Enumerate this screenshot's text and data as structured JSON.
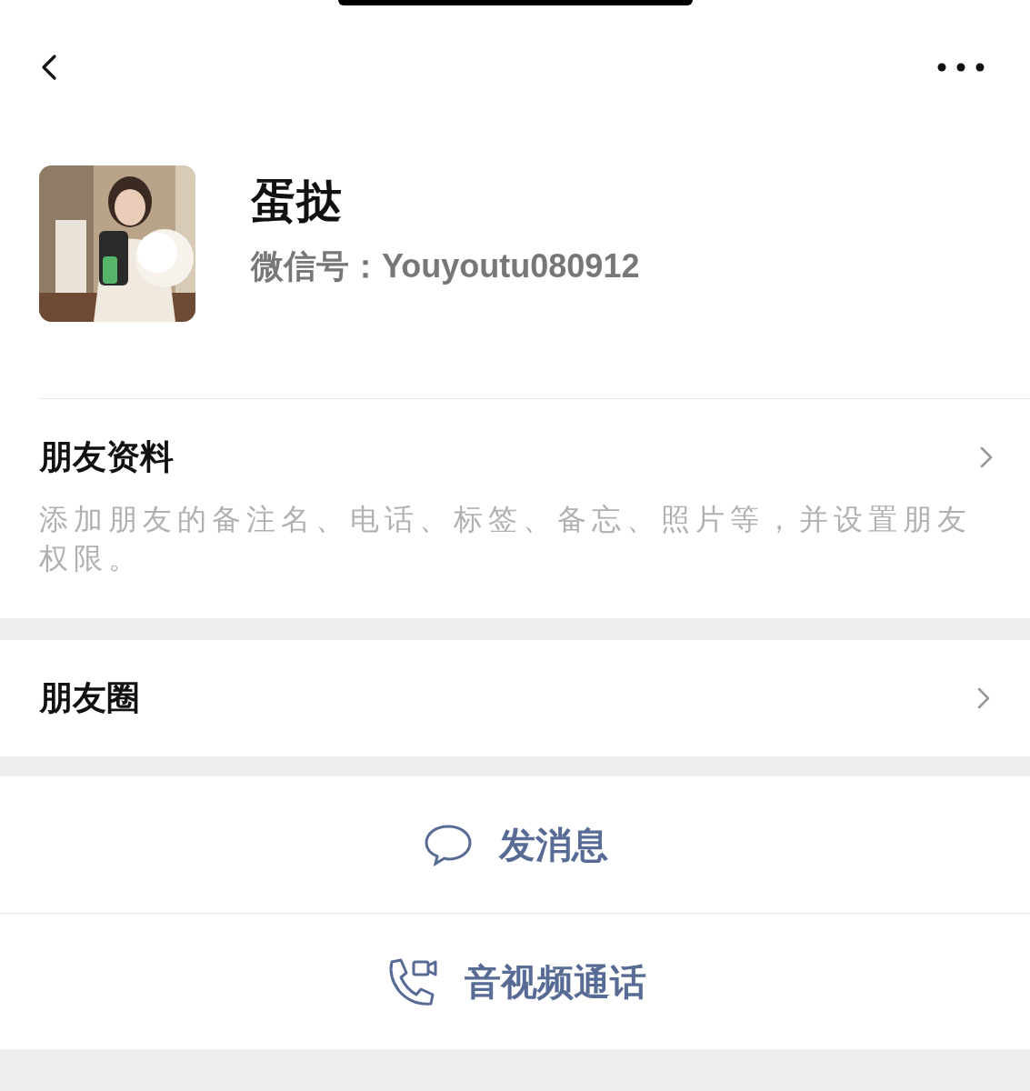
{
  "profile": {
    "name": "蛋挞",
    "wechat_id": "微信号：Youyoutu080912"
  },
  "sections": [
    {
      "title": "朋友资料",
      "description": "添加朋友的备注名、电话、标签、备忘、照片等，并设置朋友权限。"
    },
    {
      "title": "朋友圈"
    }
  ],
  "actions": [
    {
      "kind": "message",
      "label": "发消息"
    },
    {
      "kind": "call",
      "label": "音视频通话"
    }
  ]
}
